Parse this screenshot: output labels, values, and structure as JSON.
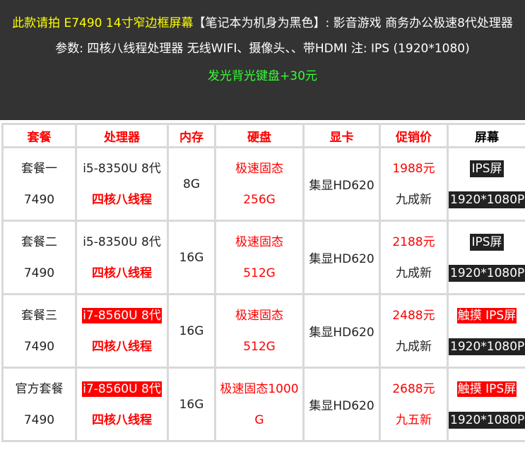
{
  "header": {
    "line1_yellow": "此款请拍 E7490 14寸窄边框屏幕",
    "line1_white": "【笔记本为机身为黑色】: 影音游戏 商务办公极速8代处理器",
    "line2": "参数: 四核八线程处理器 无线WIFI、摄像头、、带HDMI 注: IPS (1920*1080)",
    "line3": "发光背光键盘+30元"
  },
  "columns": [
    "套餐",
    "处理器",
    "内存",
    "硬盘",
    "显卡",
    "促销价",
    "屏幕"
  ],
  "rows": [
    {
      "name": "套餐一",
      "model": "7490",
      "cpu": "i5-8350U 8代",
      "cpu_highlight": false,
      "threads": "四核八线程",
      "memory": "8G",
      "disk_type": "极速固态",
      "disk_size": "256G",
      "gpu": "集显HD620",
      "price": "1988元",
      "condition": "九成新",
      "condition_red": false,
      "screen": "IPS屏",
      "screen_red": false,
      "resolution": "1920*1080P"
    },
    {
      "name": "套餐二",
      "model": "7490",
      "cpu": "i5-8350U 8代",
      "cpu_highlight": false,
      "threads": "四核八线程",
      "memory": "16G",
      "disk_type": "极速固态",
      "disk_size": "512G",
      "gpu": "集显HD620",
      "price": "2188元",
      "condition": "九成新",
      "condition_red": false,
      "screen": "IPS屏",
      "screen_red": false,
      "resolution": "1920*1080P"
    },
    {
      "name": "套餐三",
      "model": "7490",
      "cpu": "i7-8560U 8代",
      "cpu_highlight": true,
      "threads": "四核八线程",
      "memory": "16G",
      "disk_type": "极速固态",
      "disk_size": "512G",
      "gpu": "集显HD620",
      "price": "2488元",
      "condition": "九成新",
      "condition_red": false,
      "screen": "触摸 IPS屏",
      "screen_red": true,
      "resolution": "1920*1080P"
    },
    {
      "name": "官方套餐",
      "model": "7490",
      "cpu": "i7-8560U 8代",
      "cpu_highlight": true,
      "threads": "四核八线程",
      "memory": "16G",
      "disk_type": "极速固态1000",
      "disk_size": "G",
      "gpu": "集显HD620",
      "price": "2688元",
      "condition": "九五新",
      "condition_red": true,
      "screen": "触摸 IPS屏",
      "screen_red": true,
      "resolution": "1920*1080P"
    }
  ]
}
